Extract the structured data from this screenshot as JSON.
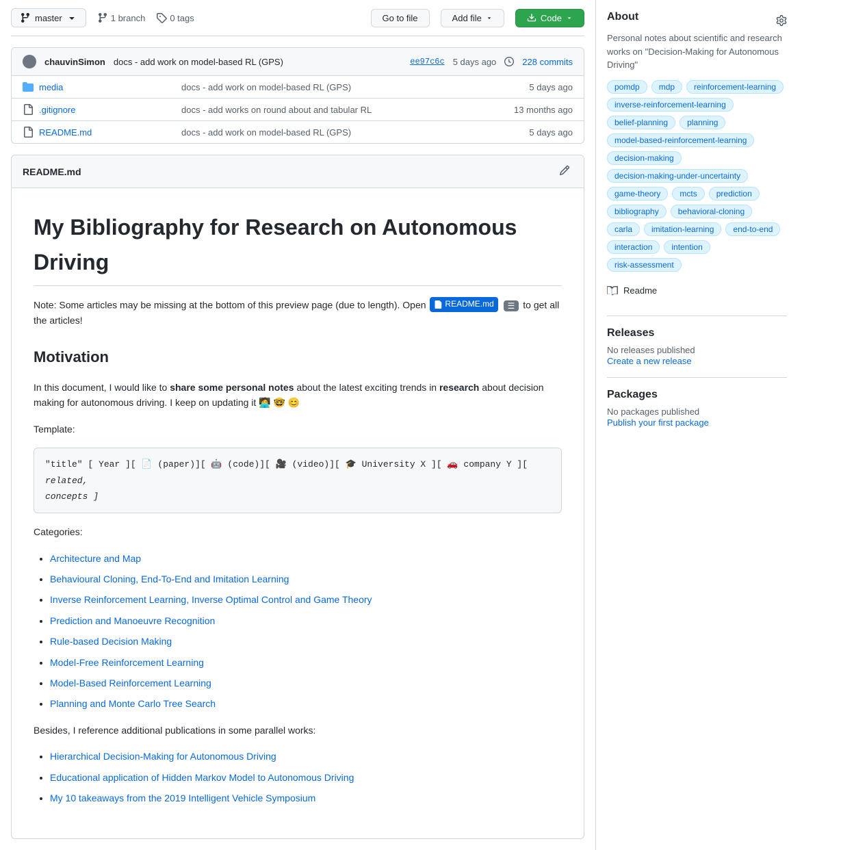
{
  "repo_bar": {
    "branch_label": "master",
    "branch_count": "1 branch",
    "tag_count": "0 tags",
    "go_to_file": "Go to file",
    "add_file": "Add file",
    "code": "Code"
  },
  "commit": {
    "author": "chauvinSimon",
    "message": "docs - add work on model-based RL (GPS)",
    "hash": "ee97c6c",
    "time": "5 days ago",
    "commits_count": "228 commits"
  },
  "files": [
    {
      "type": "folder",
      "name": "media",
      "commit_msg": "docs - add work on model-based RL (GPS)",
      "time": "5 days ago"
    },
    {
      "type": "file",
      "name": ".gitignore",
      "commit_msg": "docs - add works on round about and tabular RL",
      "time": "13 months ago"
    },
    {
      "type": "file",
      "name": "README.md",
      "commit_msg": "docs - add work on model-based RL (GPS)",
      "time": "5 days ago"
    }
  ],
  "readme": {
    "filename": "README.md",
    "title": "My Bibliography for Research on Autonomous Driving",
    "note": "Note: Some articles may be missing at the bottom of this preview page (due to length). Open",
    "note_link": "README.md",
    "note_suffix": "to get all the articles!",
    "motivation_title": "Motivation",
    "motivation_text1": "In this document, I would like to ",
    "motivation_bold": "share some personal notes",
    "motivation_text2": " about the latest exciting trends in ",
    "motivation_bold2": "research",
    "motivation_text3": " about decision making for autonomous driving. I keep on updating it 🧑‍💻 🤓 😊",
    "template_label": "Template:",
    "template_code": "\"title\" [ Year ][ 📄 (paper)][ 🤖 (code)][ 🎥 (video)][ 🎓 University X ][ 🚗 company Y ][ related, concepts ]",
    "categories_label": "Categories:",
    "categories": [
      "Architecture and Map",
      "Behavioural Cloning, End-To-End and Imitation Learning",
      "Inverse Reinforcement Learning, Inverse Optimal Control and Game Theory",
      "Prediction and Manoeuvre Recognition",
      "Rule-based Decision Making",
      "Model-Free Reinforcement Learning",
      "Model-Based Reinforcement Learning",
      "Planning and Monte Carlo Tree Search"
    ],
    "besides_text": "Besides, I reference additional publications in some parallel works:",
    "parallel_works": [
      "Hierarchical Decision-Making for Autonomous Driving",
      "Educational application of Hidden Markov Model to Autonomous Driving",
      "My 10 takeaways from the 2019 Intelligent Vehicle Symposium"
    ]
  },
  "sidebar": {
    "about_title": "About",
    "about_desc": "Personal notes about scientific and research works on \"Decision-Making for Autonomous Driving\"",
    "tags": [
      "pomdp",
      "mdp",
      "reinforcement-learning",
      "inverse-reinforcement-learning",
      "belief-planning",
      "planning",
      "model-based-reinforcement-learning",
      "decision-making",
      "decision-making-under-uncertainty",
      "game-theory",
      "mcts",
      "prediction",
      "bibliography",
      "behavioral-cloning",
      "carla",
      "imitation-learning",
      "end-to-end",
      "interaction",
      "intention",
      "risk-assessment"
    ],
    "readme_label": "Readme",
    "releases_title": "Releases",
    "no_releases": "No releases published",
    "create_release": "Create a new release",
    "packages_title": "Packages",
    "no_packages": "No packages published",
    "publish_package": "Publish your first package"
  }
}
